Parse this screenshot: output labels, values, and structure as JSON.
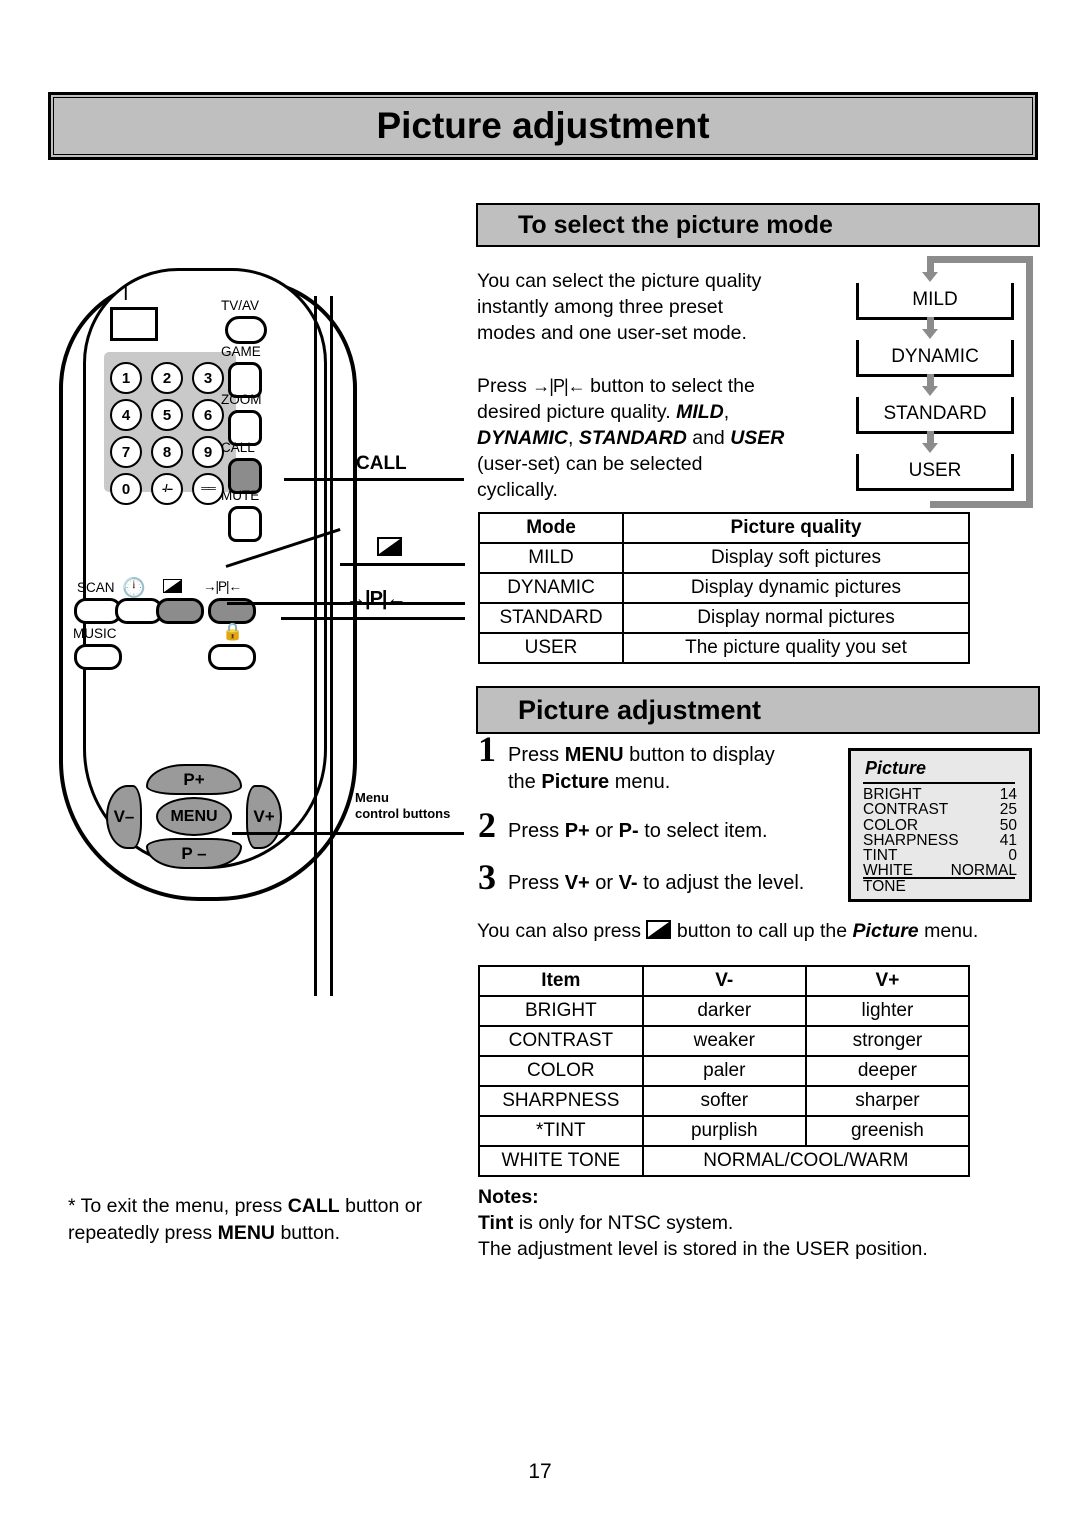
{
  "main_title": "Picture adjustment",
  "page_number": "17",
  "section_select": {
    "header": "To select the picture mode",
    "paragraph1": "You can select the picture quality instantly among three preset modes and one user-set mode.",
    "paragraph2_prefix": "Press",
    "paragraph2_button": "→|P|←",
    "paragraph2_rest_a": "button to select the desired picture quality.",
    "mode_mild": "MILD",
    "mode_dynamic": "DYNAMIC",
    "mode_standard": "STANDARD",
    "mode_user": "USER",
    "paragraph2_comma": ",",
    "paragraph2_and": "and",
    "paragraph2_tail": "(user-set) can be selected cyclically."
  },
  "flow_diagram": {
    "boxes": [
      "MILD",
      "DYNAMIC",
      "STANDARD",
      "USER"
    ],
    "loop": "cyclic",
    "arrow_color": "#8c8c8c"
  },
  "mode_table": {
    "headers": [
      "Mode",
      "Picture quality"
    ],
    "rows": [
      [
        "MILD",
        "Display soft pictures"
      ],
      [
        "DYNAMIC",
        "Display dynamic pictures"
      ],
      [
        "STANDARD",
        "Display normal pictures"
      ],
      [
        "USER",
        "The picture quality you set"
      ]
    ]
  },
  "section_adjust": {
    "header": "Picture adjustment",
    "steps": [
      {
        "num": "1",
        "text_a": "Press",
        "bold_a": "MENU",
        "text_b": "button to display the",
        "bold_b": "Picture",
        "text_c": "menu."
      },
      {
        "num": "2",
        "text_a": "Press",
        "bold_a": "P+",
        "text_b": "or",
        "bold_b": "P-",
        "text_c": "to select item."
      },
      {
        "num": "3",
        "text_a": "Press",
        "bold_a": "V+",
        "text_b": "or",
        "bold_b": "V-",
        "text_c": "to adjust the level."
      }
    ],
    "also_press_a": "You can also press",
    "also_press_icon": "contrast-icon",
    "also_press_b": "button to call up the",
    "also_press_bold": "Picture",
    "also_press_c": "menu."
  },
  "osd_menu": {
    "title": "Picture",
    "rows": [
      {
        "label": "BRIGHT",
        "value": "14"
      },
      {
        "label": "CONTRAST",
        "value": "25"
      },
      {
        "label": "COLOR",
        "value": "50"
      },
      {
        "label": "SHARPNESS",
        "value": "41"
      },
      {
        "label": "TINT",
        "value": "0"
      },
      {
        "label": "WHITE TONE",
        "value": "NORMAL"
      }
    ]
  },
  "item_table": {
    "headers": [
      "Item",
      "V-",
      "V+"
    ],
    "rows": [
      [
        "BRIGHT",
        "darker",
        "lighter"
      ],
      [
        "CONTRAST",
        "weaker",
        "stronger"
      ],
      [
        "COLOR",
        "paler",
        "deeper"
      ],
      [
        "SHARPNESS",
        "softer",
        "sharper"
      ],
      [
        "*TINT",
        "purplish",
        "greenish"
      ]
    ],
    "last_row_label": "WHITE TONE",
    "last_row_span": "NORMAL/COOL/WARM"
  },
  "notes": {
    "title": "Notes:",
    "line1_bold": "Tint",
    "line1_rest": "is only for NTSC system.",
    "line2": "The adjustment level is stored in the USER position."
  },
  "exit_note": {
    "prefix": "* To exit the menu, press",
    "bold1": "CALL",
    "middle": "button or repeatedly press",
    "bold2": "MENU",
    "suffix": "button."
  },
  "remote": {
    "power_icon": "power-icon",
    "keypad": [
      "1",
      "2",
      "3",
      "4",
      "5",
      "6",
      "7",
      "8",
      "9",
      "0",
      "-/--",
      "══"
    ],
    "side_buttons": [
      {
        "label": "TV/AV",
        "shade": "light"
      },
      {
        "label": "GAME",
        "shade": "light"
      },
      {
        "label": "ZOOM",
        "shade": "light"
      },
      {
        "label": "CALL",
        "shade": "dark"
      },
      {
        "label": "MUTE",
        "shade": "light"
      }
    ],
    "row_buttons": [
      {
        "label": "SCAN",
        "shade": "light"
      },
      {
        "label": "clock-icon",
        "shade": "light"
      },
      {
        "label": "contrast-icon",
        "shade": "dark"
      },
      {
        "label": "→|P|←",
        "shade": "dark"
      },
      {
        "label": "MUSIC",
        "shade": "light"
      },
      {
        "label": "lock-icon",
        "shade": "light"
      }
    ],
    "dpad": {
      "up": "P+",
      "down": "P –",
      "left": "V–",
      "right": "V+",
      "center": "MENU"
    },
    "callouts": {
      "call": "CALL",
      "contrast": "contrast-icon",
      "pmode": "→|P|←",
      "menu_line1": "Menu",
      "menu_line2": "control buttons"
    }
  },
  "colors": {
    "header_fill": "#bfbfbf",
    "keypad_fill": "#c9c9c9",
    "button_dark": "#8c8c8c",
    "dpad_fill": "#9a9a9a",
    "osd_fill": "#e8e8e8"
  }
}
